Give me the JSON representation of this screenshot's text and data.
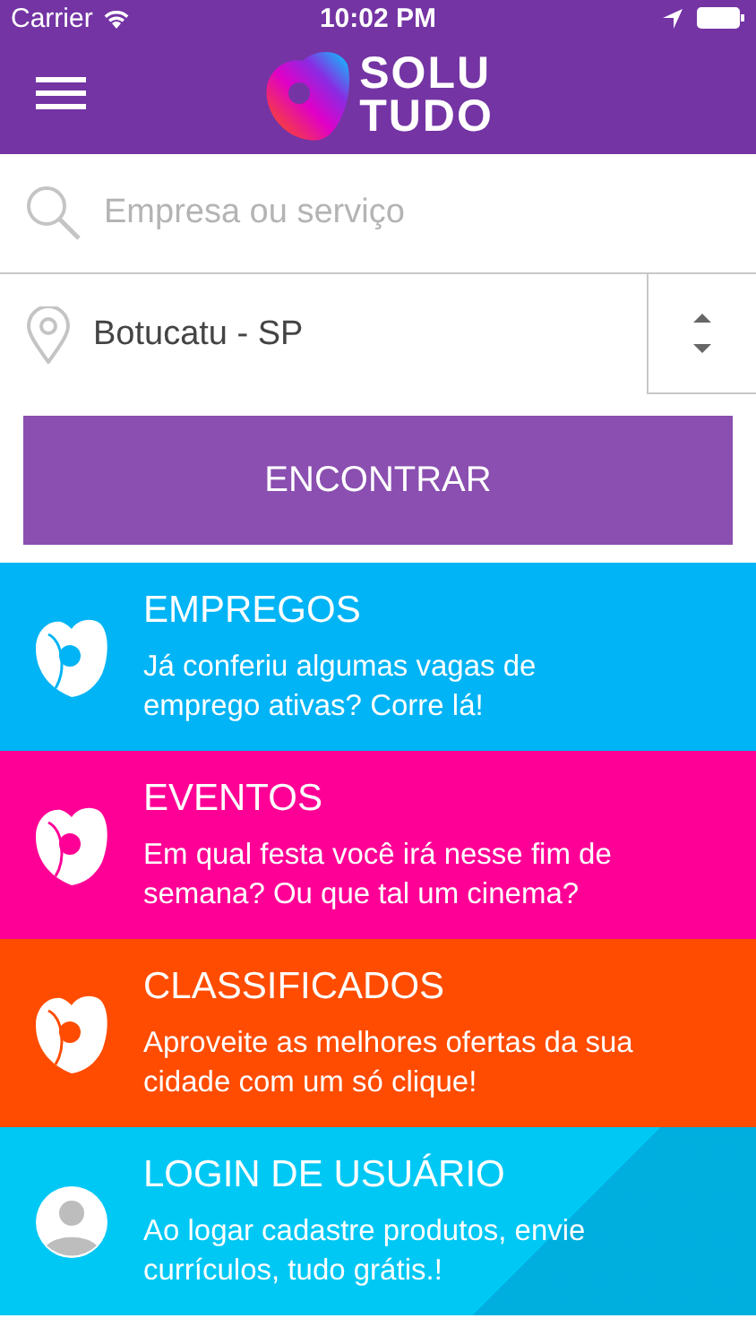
{
  "status_bar": {
    "carrier": "Carrier",
    "time": "10:02 PM"
  },
  "nav_bar": {
    "logo_top": "SOLU",
    "logo_bottom": "TUDO"
  },
  "search": {
    "placeholder": "Empresa ou serviço"
  },
  "location": {
    "value": "Botucatu - SP"
  },
  "find_button": "ENCONTRAR",
  "cards": [
    {
      "kind": "category",
      "title": "EMPREGOS",
      "text": "Já conferiu algumas vagas de emprego ativas? Corre lá!",
      "color": "#00b4f5"
    },
    {
      "kind": "category",
      "title": "EVENTOS",
      "text": "Em qual festa você irá nesse fim de semana? Ou que tal um cinema?",
      "color": "#ff0096"
    },
    {
      "kind": "category",
      "title": "CLASSIFICADOS",
      "text": "Aproveite as melhores ofertas da sua cidade com um só clique!",
      "color": "#ff4c00"
    },
    {
      "kind": "user",
      "title": "LOGIN DE USUÁRIO",
      "text": "Ao logar cadastre produtos, envie currículos, tudo grátis.!",
      "color": "#00c8f5"
    }
  ]
}
